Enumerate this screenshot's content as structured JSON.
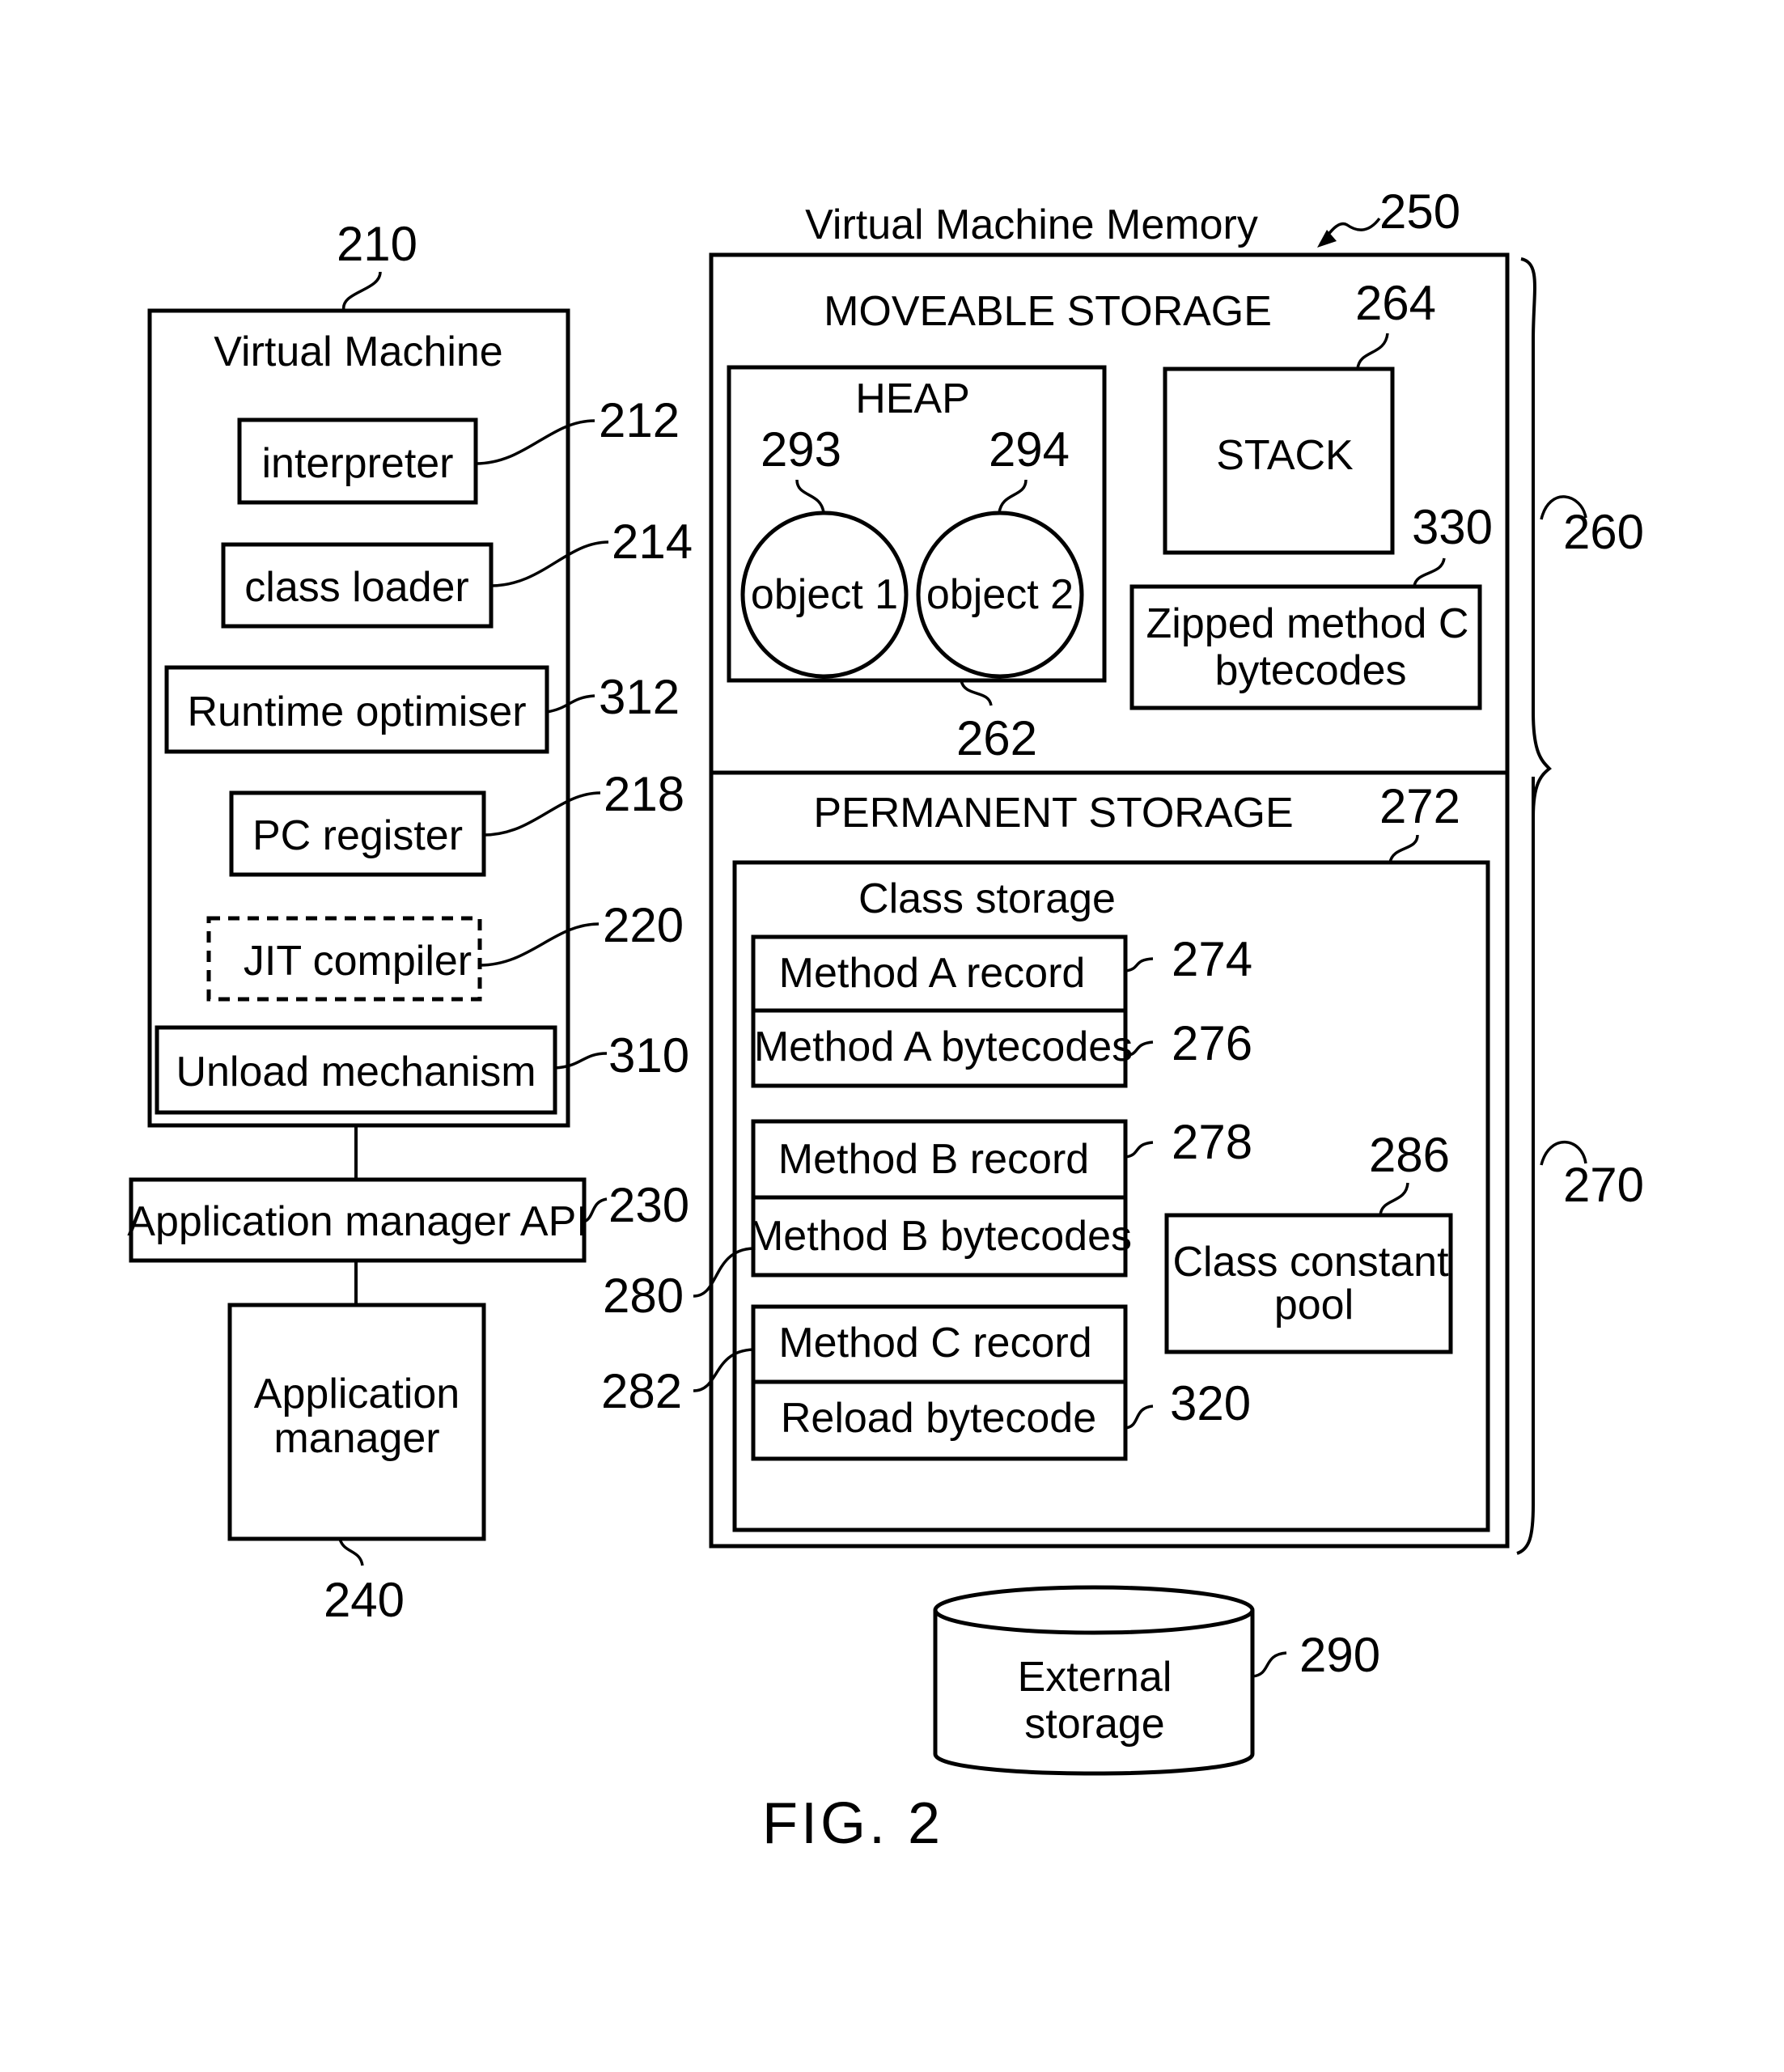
{
  "figure": {
    "caption": "FIG. 2"
  },
  "virtual_machine": {
    "ref": "210",
    "title": "Virtual Machine",
    "components": [
      {
        "label": "interpreter",
        "ref": "212",
        "style": "solid"
      },
      {
        "label": "class loader",
        "ref": "214",
        "style": "solid"
      },
      {
        "label": "Runtime optimiser",
        "ref": "312",
        "style": "solid"
      },
      {
        "label": "PC register",
        "ref": "218",
        "style": "solid"
      },
      {
        "label": "JIT compiler",
        "ref": "220",
        "style": "dashed"
      },
      {
        "label": "Unload mechanism",
        "ref": "310",
        "style": "solid"
      }
    ]
  },
  "application_manager_api": {
    "label": "Application manager API",
    "ref": "230"
  },
  "application_manager": {
    "label_line1": "Application",
    "label_line2": "manager",
    "ref": "240"
  },
  "vm_memory": {
    "title": "Virtual Machine Memory",
    "ref": "250",
    "moveable_storage": {
      "title": "MOVEABLE STORAGE",
      "brace_ref": "260",
      "heap": {
        "label": "HEAP",
        "ref": "262",
        "objects": [
          {
            "label": "object 1",
            "ref": "293"
          },
          {
            "label": "object 2",
            "ref": "294"
          }
        ]
      },
      "stack": {
        "label": "STACK",
        "ref": "264"
      },
      "zipped": {
        "label_line1": "Zipped method C",
        "label_line2": "bytecodes",
        "ref": "330"
      }
    },
    "permanent_storage": {
      "title": "PERMANENT STORAGE",
      "brace_ref": "270",
      "class_storage": {
        "title": "Class storage",
        "ref": "272",
        "records": [
          {
            "label": "Method A record",
            "ref": "274"
          },
          {
            "label": "Method A bytecodes",
            "ref": "276"
          },
          {
            "label": "Method B record",
            "ref": "278"
          },
          {
            "label": "Method B bytecodes",
            "ref": "280"
          },
          {
            "label": "Method C record",
            "ref": "282"
          },
          {
            "label": "Reload bytecode",
            "ref": "320"
          }
        ],
        "constant_pool": {
          "label_line1": "Class constant",
          "label_line2": "pool",
          "ref": "286"
        }
      }
    }
  },
  "external_storage": {
    "label_line1": "External",
    "label_line2": "storage",
    "ref": "290"
  }
}
